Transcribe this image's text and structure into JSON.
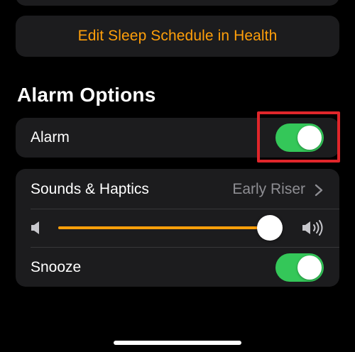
{
  "edit_schedule": {
    "label": "Edit Sleep Schedule in Health"
  },
  "section": {
    "title": "Alarm Options"
  },
  "alarm": {
    "label": "Alarm",
    "enabled": true
  },
  "sounds": {
    "label": "Sounds & Haptics",
    "value": "Early Riser",
    "chevron_icon": "chevron-right-icon"
  },
  "volume": {
    "level": 0.98,
    "low_icon": "speaker-low-icon",
    "high_icon": "speaker-high-icon"
  },
  "snooze": {
    "label": "Snooze",
    "enabled": true
  },
  "colors": {
    "accent": "#ff9f0a",
    "toggle_on": "#34c759",
    "card_background": "#1c1c1e",
    "secondary_text": "#8e8e93",
    "highlight": "#e0262b"
  }
}
